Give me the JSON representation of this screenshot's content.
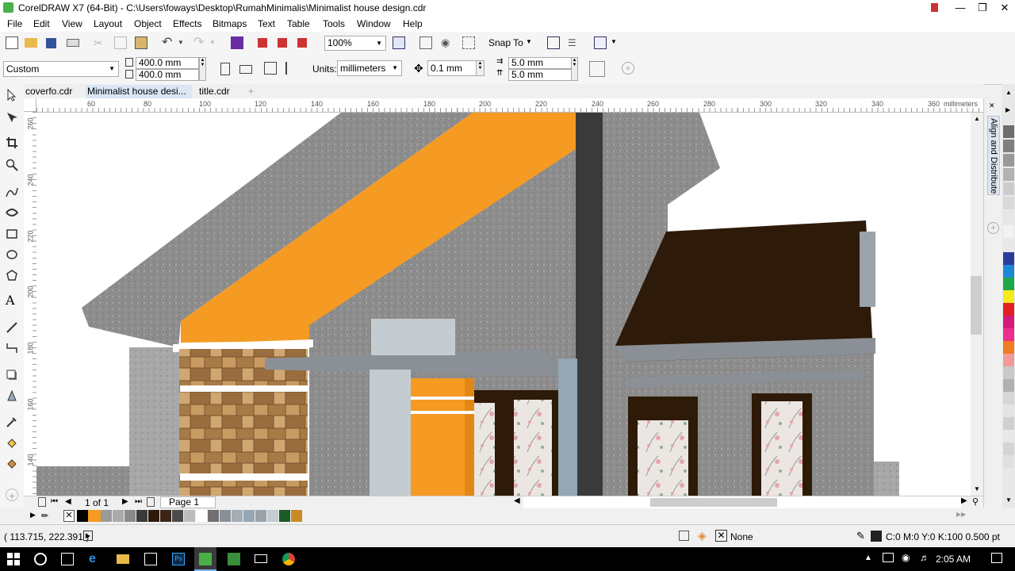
{
  "window": {
    "title": "CorelDRAW X7 (64-Bit) - C:\\Users\\foways\\Desktop\\RumahMinimalis\\Minimalist house design.cdr"
  },
  "menu": [
    "File",
    "Edit",
    "View",
    "Layout",
    "Object",
    "Effects",
    "Bitmaps",
    "Text",
    "Table",
    "Tools",
    "Window",
    "Help"
  ],
  "toolbar": {
    "zoom": "100%",
    "snap_label": "Snap To"
  },
  "propbar": {
    "page_preset": "Custom",
    "width": "400.0 mm",
    "height": "400.0 mm",
    "units_label": "Units:",
    "units_value": "millimeters",
    "nudge": "0.1 mm",
    "dup_x": "5.0 mm",
    "dup_y": "5.0 mm"
  },
  "tabs": [
    "coverfo.cdr",
    "Minimalist house desi...",
    "title.cdr",
    "+"
  ],
  "hruler": {
    "ticks": [
      "60",
      "80",
      "100",
      "120",
      "140",
      "160",
      "180",
      "200",
      "220",
      "240",
      "260",
      "280",
      "300",
      "320",
      "340",
      "360"
    ],
    "unit": "millimeters"
  },
  "vruler": {
    "ticks": [
      "260",
      "240",
      "220",
      "200",
      "180",
      "160",
      "140"
    ],
    "unit": "millimeters"
  },
  "docker": {
    "title": "Align and Distribute"
  },
  "pagenav": {
    "count": "1 of 1",
    "page_tab": "Page 1"
  },
  "status": {
    "coords": "( 113.715, 222.391 )",
    "fill": "None",
    "outline": "C:0 M:0 Y:0 K:100  0.500 pt"
  },
  "taskbar": {
    "time": "2:05 AM"
  },
  "colors": {
    "orange": "#f59a23",
    "roof_brown": "#2e1a08",
    "dark_pillar": "#3a3a3a",
    "concrete": "#8c8c8c",
    "trim_grey": "#8a9096"
  }
}
